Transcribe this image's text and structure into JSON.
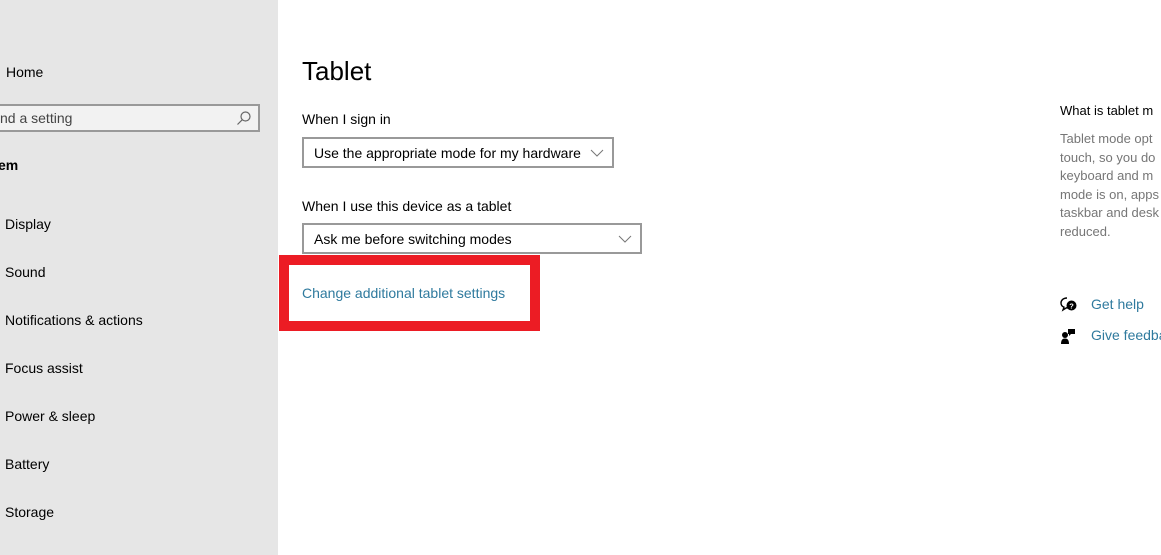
{
  "sidebar": {
    "home_label": "Home",
    "search_placeholder": "Find a setting",
    "search_visible_text": "nd a setting",
    "section_title": "System",
    "section_title_visible": "em",
    "items": [
      {
        "label": "Display"
      },
      {
        "label": "Sound"
      },
      {
        "label": "Notifications & actions"
      },
      {
        "label": "Focus assist"
      },
      {
        "label": "Power & sleep"
      },
      {
        "label": "Battery"
      },
      {
        "label": "Storage"
      }
    ]
  },
  "main": {
    "title": "Tablet",
    "sign_in": {
      "label": "When I sign in",
      "selected": "Use the appropriate mode for my hardware"
    },
    "tablet_use": {
      "label": "When I use this device as a tablet",
      "selected": "Ask me before switching modes"
    },
    "additional_link": "Change additional tablet settings",
    "highlight_color": "#ec1c24"
  },
  "aside": {
    "title": "What is tablet mode?",
    "title_visible": "What is tablet m",
    "description_lines": [
      "Tablet mode opt",
      "touch, so you do",
      "keyboard and m",
      "mode is on, apps",
      "taskbar and desk",
      "reduced."
    ],
    "get_help": "Get help",
    "give_feedback": "Give feedback"
  },
  "colors": {
    "sidebar_bg": "#e6e6e6",
    "link": "#2f7a9e",
    "highlight": "#ec1c24"
  }
}
